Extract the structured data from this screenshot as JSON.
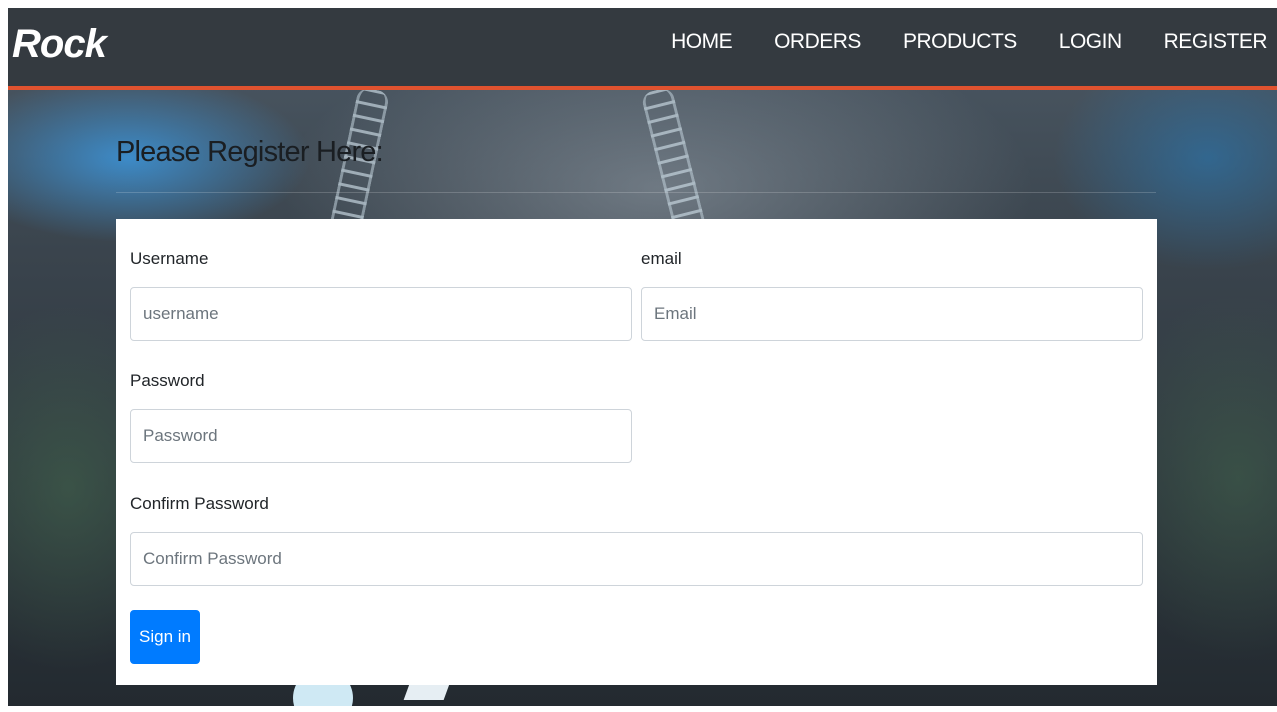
{
  "navbar": {
    "brand": "Rock",
    "links": [
      "HOME",
      "ORDERS",
      "PRODUCTS",
      "LOGIN",
      "REGISTER"
    ],
    "accent_color": "#e0522f",
    "background_color": "#343a40"
  },
  "page": {
    "heading": "Please Register Here:"
  },
  "form": {
    "username": {
      "label": "Username",
      "placeholder": "username",
      "value": ""
    },
    "email": {
      "label": "email",
      "placeholder": "Email",
      "value": ""
    },
    "password": {
      "label": "Password",
      "placeholder": "Password",
      "value": ""
    },
    "confirm_password": {
      "label": "Confirm Password",
      "placeholder": "Confirm Password",
      "value": ""
    },
    "submit_label": "Sign in",
    "submit_color": "#007bff"
  }
}
